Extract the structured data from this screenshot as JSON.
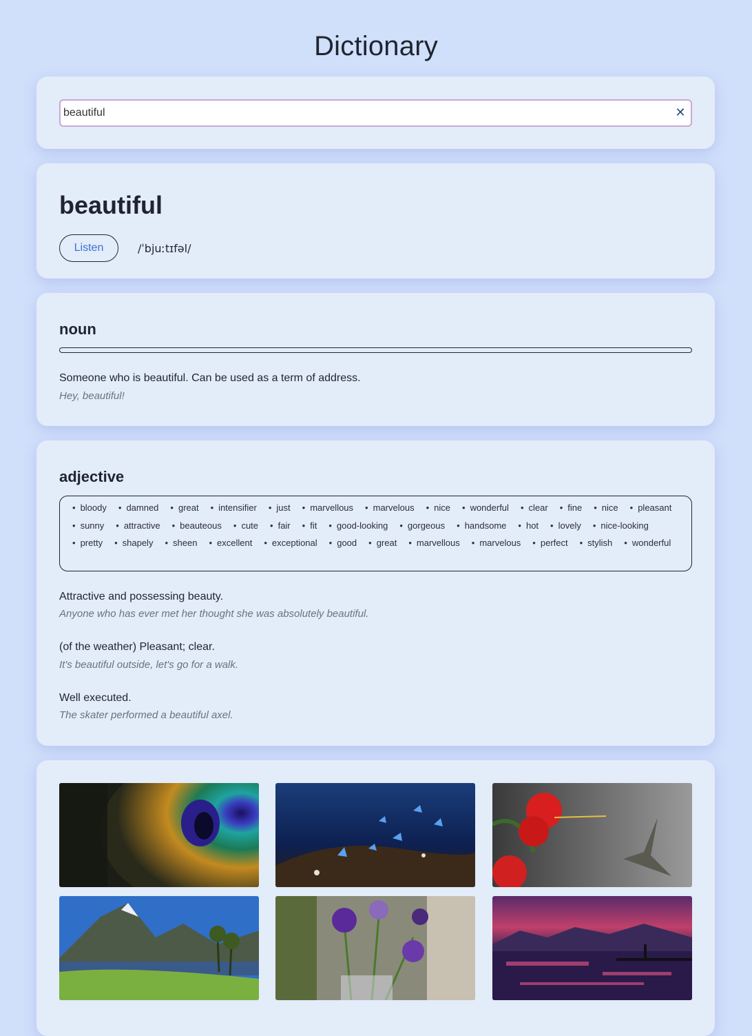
{
  "app": {
    "title": "Dictionary"
  },
  "search": {
    "value": "beautiful",
    "clear_icon": "close-icon"
  },
  "word": {
    "text": "beautiful",
    "listen_label": "Listen",
    "phonetic": "/ˈbjuːtɪfəl/"
  },
  "meanings": [
    {
      "part_of_speech": "noun",
      "definitions": [
        {
          "definition": "Someone who is beautiful. Can be used as a term of address.",
          "example": "Hey, beautiful!"
        }
      ]
    },
    {
      "part_of_speech": "adjective",
      "synonyms": [
        "bloody",
        "damned",
        "great",
        "intensifier",
        "just",
        "marvellous",
        "marvelous",
        "nice",
        "wonderful",
        "clear",
        "fine",
        "nice",
        "pleasant",
        "sunny",
        "attractive",
        "beauteous",
        "cute",
        "fair",
        "fit",
        "good-looking",
        "gorgeous",
        "handsome",
        "hot",
        "lovely",
        "nice-looking",
        "pretty",
        "shapely",
        "sheen",
        "excellent",
        "exceptional",
        "good",
        "great",
        "marvellous",
        "marvelous",
        "perfect",
        "stylish",
        "wonderful"
      ],
      "definitions": [
        {
          "definition": "Attractive and possessing beauty.",
          "example": "Anyone who has ever met her thought she was absolutely beautiful."
        },
        {
          "definition": "(of the weather) Pleasant; clear.",
          "example": "It's beautiful outside, let's go for a walk."
        },
        {
          "definition": "Well executed.",
          "example": "The skater performed a beautiful axel."
        }
      ]
    }
  ],
  "images": [
    "peacock-feather-photo",
    "blue-butterflies-photo",
    "hummingbird-hibiscus-photo",
    "mountain-lake-photo",
    "purple-flowers-vase-photo",
    "sunset-lake-photo"
  ]
}
